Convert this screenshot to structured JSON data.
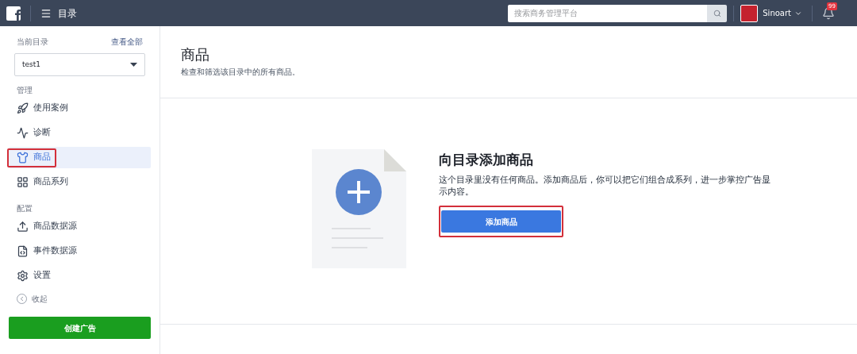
{
  "header": {
    "title": "目录",
    "search": {
      "placeholder": "搜索商务管理平台"
    },
    "account": "Sinoart",
    "notifications": "99"
  },
  "sidebar": {
    "catalog_label": "当前目录",
    "view_all": "查看全部",
    "catalog": "test1",
    "sections": [
      {
        "title": "管理",
        "items": [
          {
            "label": "使用案例",
            "selected": false,
            "highlighted": false
          },
          {
            "label": "诊断",
            "selected": false,
            "highlighted": false
          },
          {
            "label": "商品",
            "selected": true,
            "highlighted": true
          },
          {
            "label": "商品系列",
            "selected": false,
            "highlighted": false
          }
        ]
      },
      {
        "title": "配置",
        "items": [
          {
            "label": "商品数据源",
            "selected": false,
            "highlighted": false
          },
          {
            "label": "事件数据源",
            "selected": false,
            "highlighted": false
          },
          {
            "label": "设置",
            "selected": false,
            "highlighted": false
          }
        ]
      }
    ],
    "collapse": "收起",
    "create_ad": "创建广告"
  },
  "page": {
    "title": "商品",
    "subtitle": "检查和筛选该目录中的所有商品。"
  },
  "empty_state": {
    "title": "向目录添加商品",
    "text": "这个目录里没有任何商品。添加商品后，你可以把它们组合成系列，进一步掌控广告显示内容。",
    "button": "添加商品",
    "button_highlighted": true
  }
}
